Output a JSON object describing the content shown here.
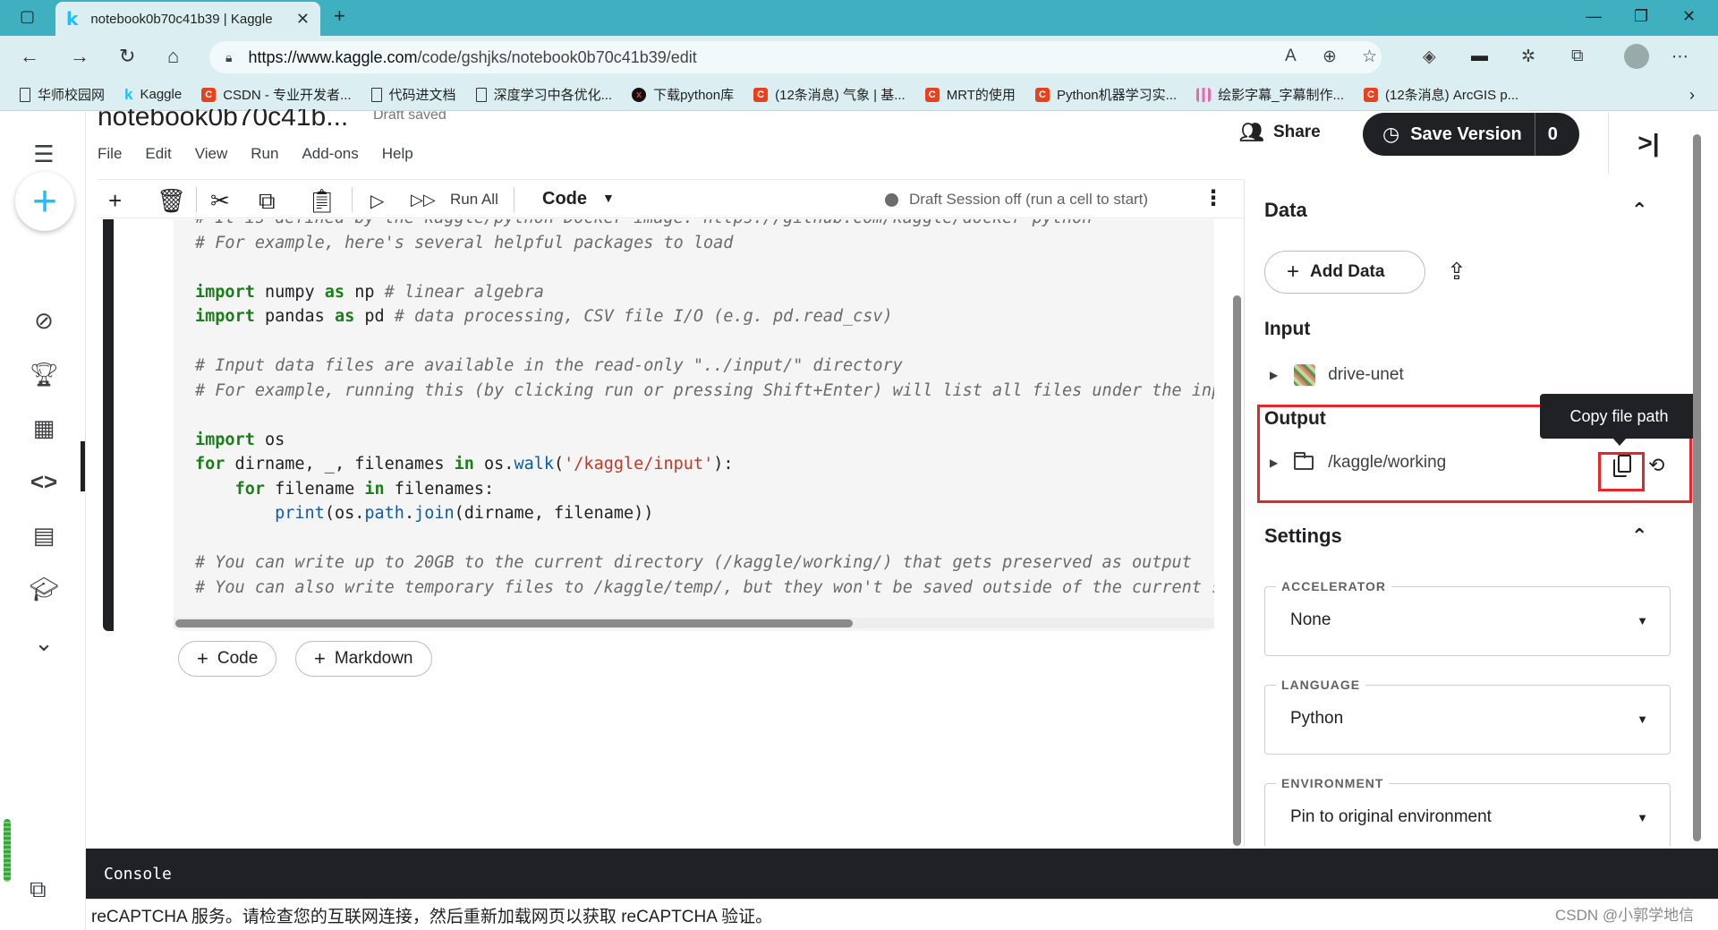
{
  "browser": {
    "tab_title": "notebook0b70c41b39 | Kaggle",
    "tab_icon": "kaggle-k-icon",
    "url_host": "https://www.kaggle.com",
    "url_path": "/code/gshjks/notebook0b70c41b39/edit",
    "bookmarks": [
      {
        "label": "华师校园网",
        "icon": "doc-icon"
      },
      {
        "label": "Kaggle",
        "icon": "kaggle-k-icon"
      },
      {
        "label": "CSDN - 专业开发者...",
        "icon": "csdn-c-icon"
      },
      {
        "label": "代码进文档",
        "icon": "doc-icon"
      },
      {
        "label": "深度学习中各优化...",
        "icon": "doc-icon"
      },
      {
        "label": "下载python库",
        "icon": "dark-circle-icon"
      },
      {
        "label": "(12条消息) 气象 | 基...",
        "icon": "csdn-c-icon"
      },
      {
        "label": "MRT的使用",
        "icon": "csdn-c-icon"
      },
      {
        "label": "Python机器学习实...",
        "icon": "csdn-c-icon"
      },
      {
        "label": "绘影字幕_字幕制作...",
        "icon": "lines-icon"
      },
      {
        "label": "(12条消息) ArcGIS p...",
        "icon": "csdn-c-icon"
      }
    ]
  },
  "notebook": {
    "title": "notebook0b70c41b...",
    "save_status": "Draft saved",
    "menu": [
      "File",
      "Edit",
      "View",
      "Run",
      "Add-ons",
      "Help"
    ],
    "share_label": "Share",
    "save_version_label": "Save Version",
    "save_version_count": "0"
  },
  "toolbar": {
    "run_all_label": "Run All",
    "cell_type": "Code",
    "session_status": "Draft Session off (run a cell to start)"
  },
  "cell_buttons": {
    "code_label": "Code",
    "markdown_label": "Markdown"
  },
  "right_panel": {
    "data_header": "Data",
    "add_data_label": "Add Data",
    "input_header": "Input",
    "input_items": [
      "drive-unet"
    ],
    "output_header": "Output",
    "output_items": [
      "/kaggle/working"
    ],
    "tooltip": "Copy file path",
    "settings_header": "Settings",
    "settings": [
      {
        "label": "ACCELERATOR",
        "value": "None"
      },
      {
        "label": "LANGUAGE",
        "value": "Python"
      },
      {
        "label": "ENVIRONMENT",
        "value": "Pin to original environment"
      }
    ]
  },
  "console": {
    "title": "Console",
    "message": "reCAPTCHA 服务。请检查您的互联网连接，然后重新加载网页以获取 reCAPTCHA 验证。"
  },
  "watermark": "CSDN @小郭学地信",
  "colors": {
    "browser_teal": "#3fb0c0",
    "kaggle_blue": "#20beff",
    "dark": "#202124",
    "highlight_red": "#e5262a"
  }
}
